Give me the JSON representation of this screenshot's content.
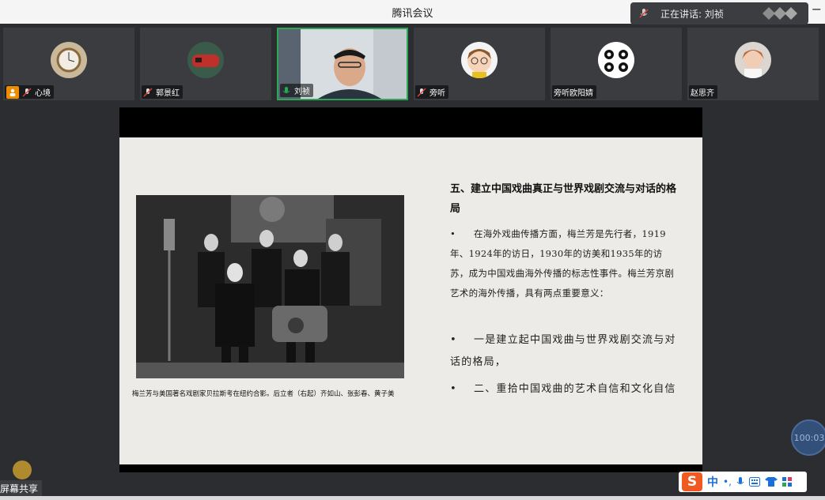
{
  "window": {
    "title": "腾讯会议"
  },
  "speaking": {
    "text": "正在讲话: 刘祯"
  },
  "participants": [
    {
      "name": "心境"
    },
    {
      "name": "郭景红"
    },
    {
      "name": "刘祯"
    },
    {
      "name": "旁听"
    },
    {
      "name": "旁听欧阳婧"
    },
    {
      "name": "赵思齐"
    }
  ],
  "slide": {
    "heading": "五、建立中国戏曲真正与世界戏剧交流与对话的格局",
    "bullet_symbol": "•",
    "paragraph1": "在海外戏曲传播方面，梅兰芳是先行者，1919年、1924年的访日，1930年的访美和1935年的访苏，成为中国戏曲海外传播的标志性事件。梅兰芳京剧艺术的海外传播，具有两点重要意义：",
    "paragraph2": "一是建立起中国戏曲与世界戏剧交流与对话的格局，",
    "paragraph3": "二、重拾中国戏曲的艺术自信和文化自信",
    "caption": "梅兰芳与美国著名戏剧家贝拉斯考在纽约合影。后立者（右起）齐如山、张彭春、黄子美"
  },
  "share_label": "屏幕共享",
  "timer": "100:03",
  "ime": {
    "logo": "S",
    "lang": "中"
  },
  "colors": {
    "active_border": "#2aa857",
    "host_badge": "#f08c00",
    "ime_logo": "#f05a22"
  }
}
